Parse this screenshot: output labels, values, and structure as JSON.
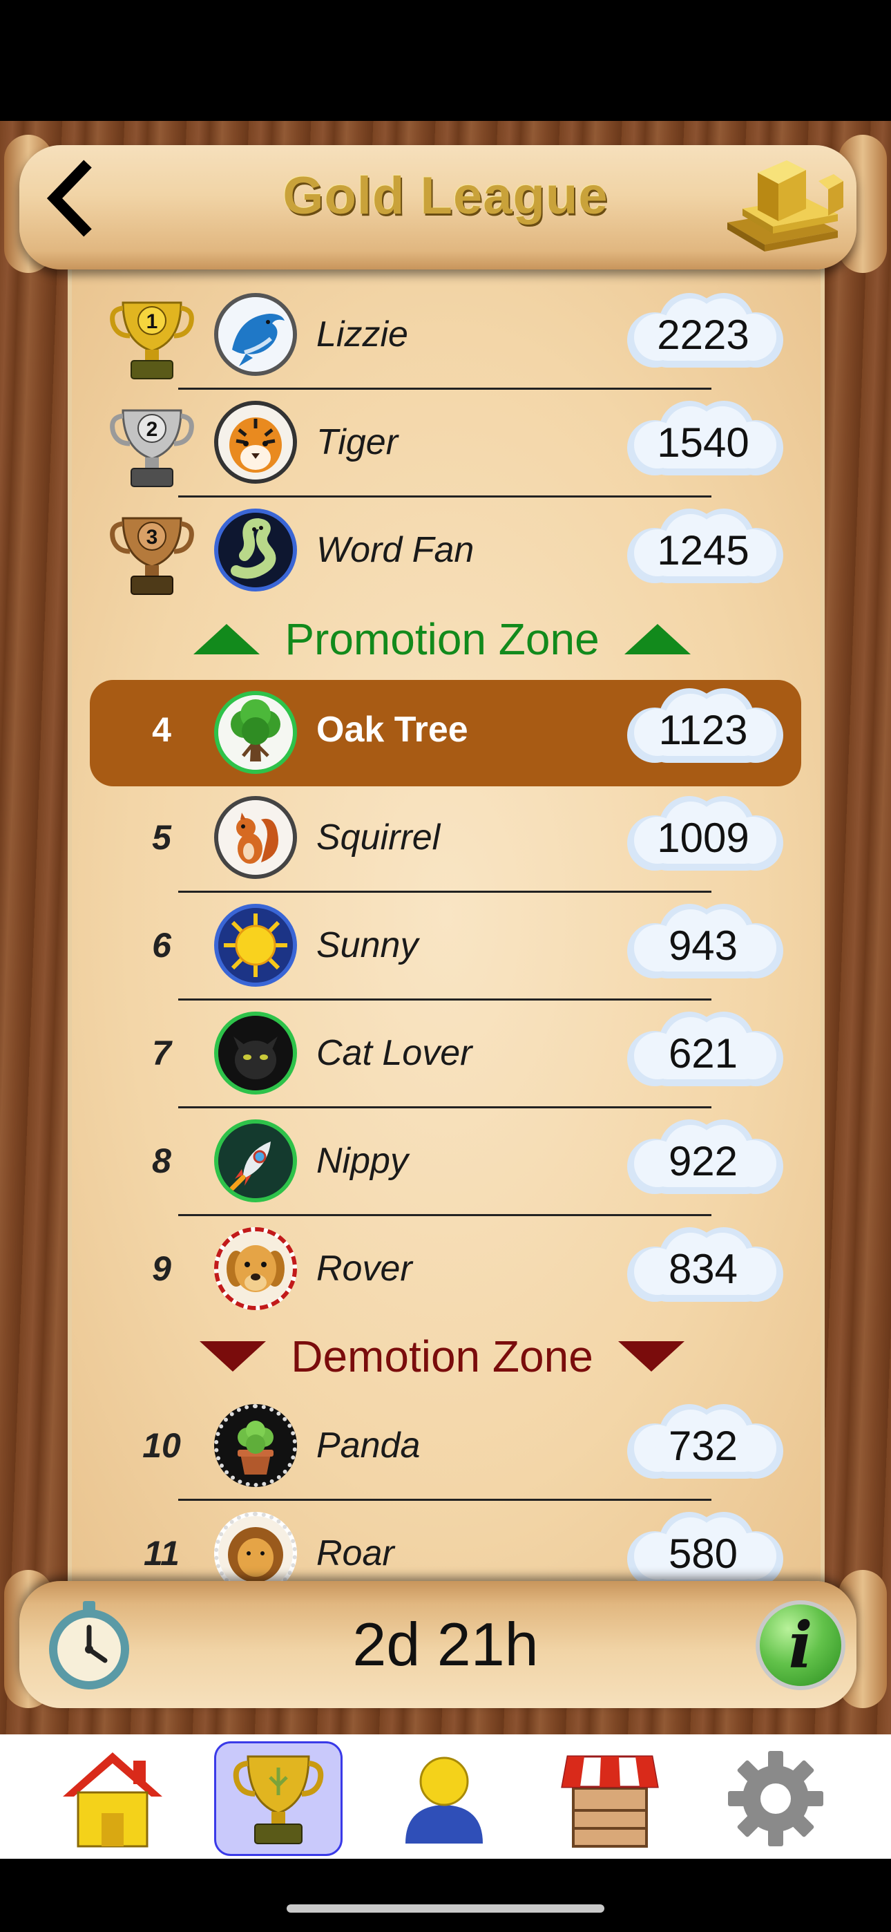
{
  "header": {
    "title": "Gold League",
    "back_icon": "chevron-left-icon",
    "badge_icon": "gold-bars-icon"
  },
  "top_ranks": [
    {
      "rank": "1",
      "name": "Lizzie",
      "score": "2223",
      "avatar": "dolphin",
      "ring": "#555555"
    },
    {
      "rank": "2",
      "name": "Tiger",
      "score": "1540",
      "avatar": "tiger",
      "ring": "#333333"
    },
    {
      "rank": "3",
      "name": "Word Fan",
      "score": "1245",
      "avatar": "worm",
      "ring": "#3a66d6"
    }
  ],
  "promotion_zone": {
    "label": "Promotion Zone",
    "color": "#128a1c"
  },
  "current_player": {
    "rank": "4",
    "name": "Oak Tree",
    "score": "1123",
    "avatar": "tree",
    "highlight_color": "#a85b14"
  },
  "middle_ranks": [
    {
      "rank": "5",
      "name": "Squirrel",
      "score": "1009",
      "avatar": "squirrel"
    },
    {
      "rank": "6",
      "name": "Sunny",
      "score": "943",
      "avatar": "sun"
    },
    {
      "rank": "7",
      "name": "Cat Lover",
      "score": "621",
      "avatar": "cat"
    },
    {
      "rank": "8",
      "name": "Nippy",
      "score": "922",
      "avatar": "rocket"
    },
    {
      "rank": "9",
      "name": "Rover",
      "score": "834",
      "avatar": "dog"
    }
  ],
  "demotion_zone": {
    "label": "Demotion Zone",
    "color": "#7a0c0c"
  },
  "bottom_ranks": [
    {
      "rank": "10",
      "name": "Panda",
      "score": "732",
      "avatar": "cactus"
    },
    {
      "rank": "11",
      "name": "Roar",
      "score": "580",
      "avatar": "lion"
    }
  ],
  "footer": {
    "time_remaining": "2d 21h",
    "timer_icon": "stopwatch-icon",
    "info_icon": "info-icon"
  },
  "tab_bar": {
    "tabs": [
      {
        "name": "home",
        "icon": "house-icon",
        "active": false
      },
      {
        "name": "leagues",
        "icon": "trophy-icon",
        "active": true
      },
      {
        "name": "profile",
        "icon": "person-icon",
        "active": false
      },
      {
        "name": "shop",
        "icon": "shop-icon",
        "active": false
      },
      {
        "name": "settings",
        "icon": "gear-icon",
        "active": false
      }
    ]
  }
}
